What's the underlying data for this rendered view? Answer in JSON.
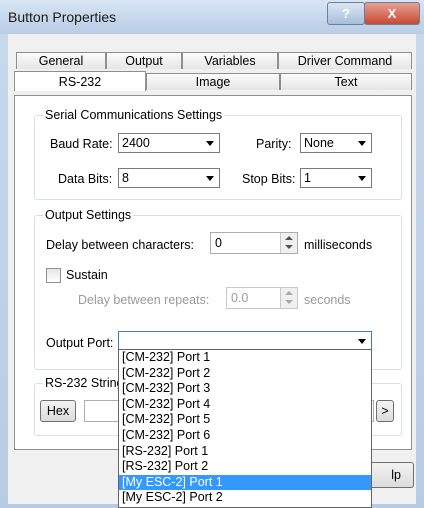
{
  "window": {
    "title": "Button Properties",
    "help_label": "?",
    "close_label": "X"
  },
  "tabs_row1": [
    "General",
    "Output",
    "Variables",
    "Driver Command"
  ],
  "tabs_row2": [
    "RS-232",
    "Image",
    "Text"
  ],
  "active_tab": "RS-232",
  "serial": {
    "legend": "Serial Communications Settings",
    "baud_label": "Baud Rate:",
    "baud_value": "2400",
    "parity_label": "Parity:",
    "parity_value": "None",
    "databits_label": "Data Bits:",
    "databits_value": "8",
    "stopbits_label": "Stop Bits:",
    "stopbits_value": "1"
  },
  "output": {
    "legend": "Output Settings",
    "delay_label": "Delay between characters:",
    "delay_value": "0",
    "delay_unit": "milliseconds",
    "sustain_label": "Sustain",
    "repeat_label": "Delay between repeats:",
    "repeat_value": "0.0",
    "repeat_unit": "seconds",
    "port_label": "Output Port:",
    "port_value": ""
  },
  "rs232_string": {
    "legend": "RS-232 String",
    "hex_label": "Hex",
    "next_label": ">"
  },
  "footer": {
    "partial_button": "lp"
  },
  "port_options": [
    "[CM-232] Port 1",
    "[CM-232] Port 2",
    "[CM-232] Port 3",
    "[CM-232] Port 4",
    "[CM-232] Port 5",
    "[CM-232] Port 6",
    "[RS-232] Port 1",
    "[RS-232] Port 2",
    "[My ESC-2] Port 1",
    "[My ESC-2] Port 2"
  ],
  "selected_option_index": 8,
  "colors": {
    "selection": "#3399ff",
    "close_button": "#c64a33"
  }
}
